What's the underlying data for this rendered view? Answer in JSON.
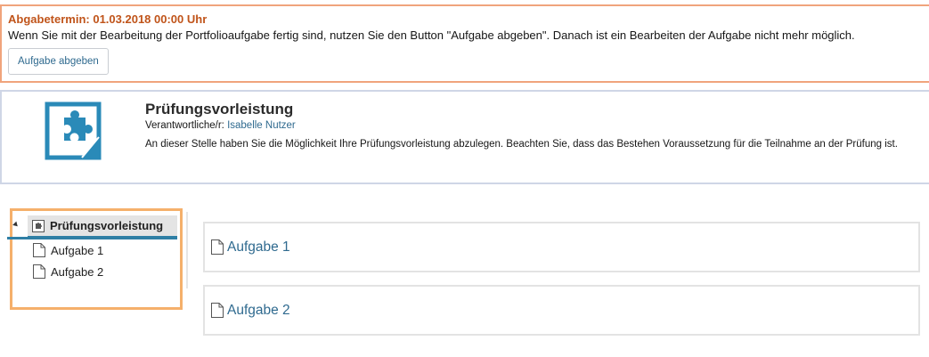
{
  "notice": {
    "title": "Abgabetermin: 01.03.2018 00:00 Uhr",
    "text": "Wenn Sie mit der Bearbeitung der Portfolioaufgabe fertig sind, nutzen Sie den Button \"Aufgabe abgeben\". Danach ist ein Bearbeiten der Aufgabe nicht mehr möglich.",
    "button_label": "Aufgabe abgeben",
    "accent_color": "#c0541a",
    "border_color": "#f0a47c"
  },
  "info": {
    "icon": "puzzle-piece-icon",
    "title": "Prüfungsvorleistung",
    "responsible_label": "Verantwortliche/r:",
    "responsible_name": "Isabelle Nutzer",
    "description": "An dieser Stelle haben Sie die Möglichkeit Ihre Prüfungsvorleistung abzulegen. Beachten Sie, dass das Bestehen Voraussetzung für die Teilnahme an der Prüfung ist."
  },
  "tree": {
    "root": {
      "label": "Prüfungsvorleistung",
      "icon": "portfolio-icon"
    },
    "items": [
      {
        "label": "Aufgabe 1",
        "icon": "document-icon"
      },
      {
        "label": "Aufgabe 2",
        "icon": "document-icon"
      }
    ],
    "highlight_color": "#f5b06b",
    "selected_color": "#2f7fa5"
  },
  "cards": [
    {
      "label": "Aufgabe 1",
      "icon": "document-icon"
    },
    {
      "label": "Aufgabe 2",
      "icon": "document-icon"
    }
  ],
  "link_color": "#2f6a8f"
}
